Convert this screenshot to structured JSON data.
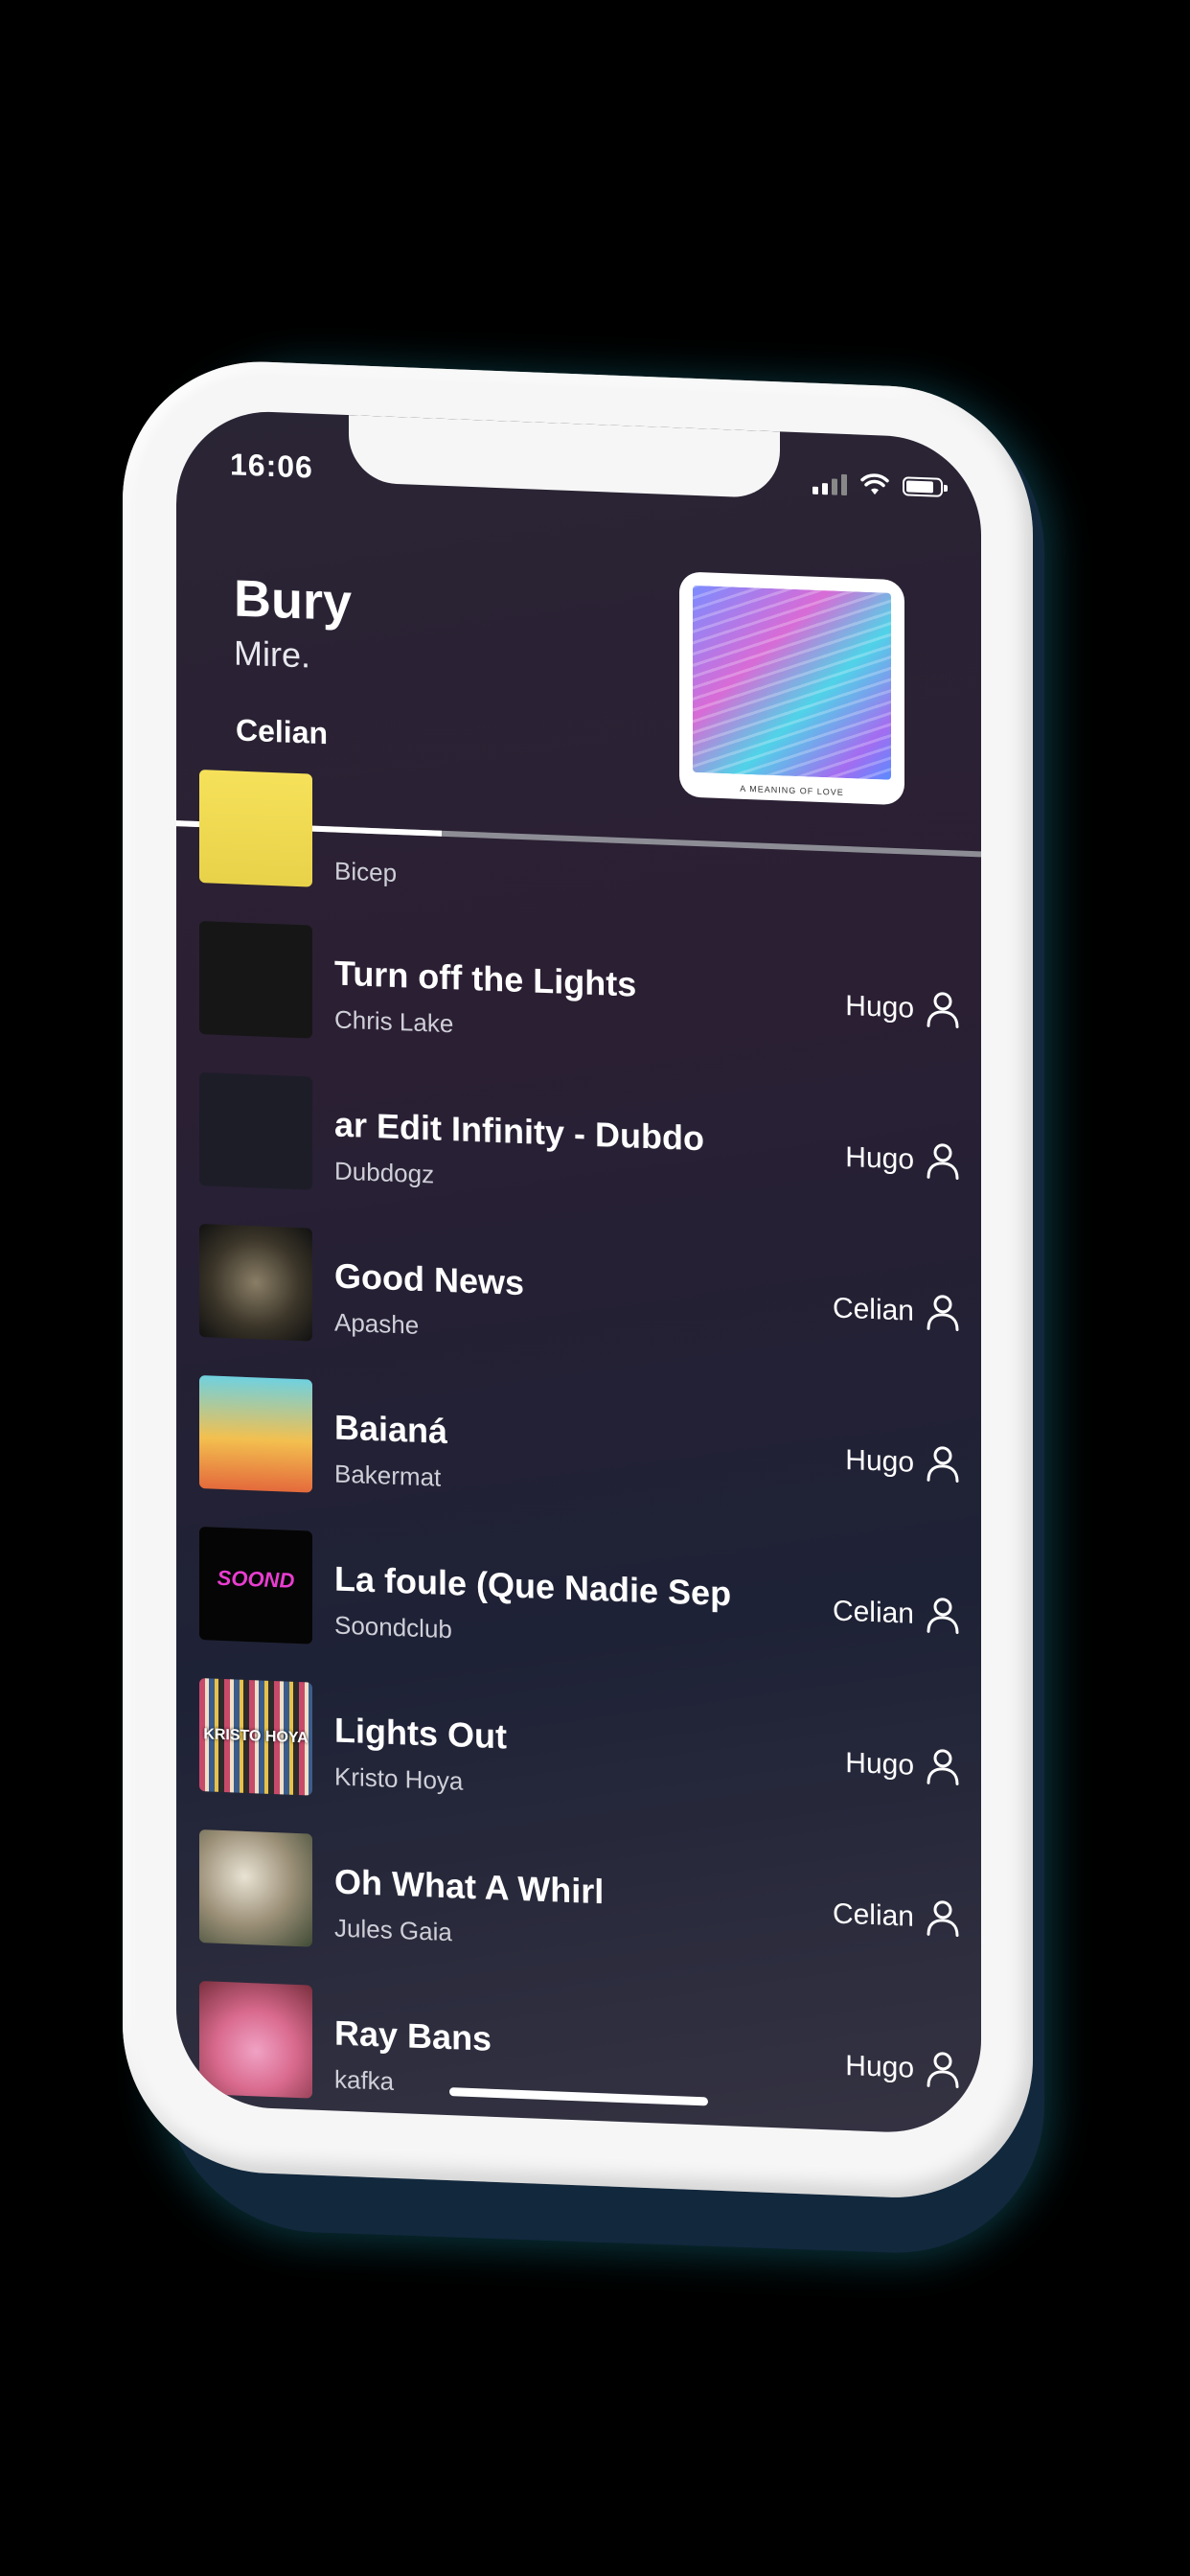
{
  "status_bar": {
    "time": "16:06"
  },
  "now_playing": {
    "title": "Bury",
    "artist": "Mire.",
    "added_by": "Celian",
    "cover_caption": "A MEANING OF LOVE",
    "progress": 0.33
  },
  "queue": [
    {
      "title": "",
      "artist": "Bicep",
      "added_by": "",
      "cover_icon": "bicep-cover"
    },
    {
      "title": "Turn off the Lights",
      "artist": "Chris Lake",
      "added_by": "Hugo",
      "cover_icon": "chris-lake-cover"
    },
    {
      "title": "ar Edit     Infinity - Dubdo",
      "artist": "Dubdogz",
      "added_by": "Hugo",
      "cover_icon": "dubdogz-cover"
    },
    {
      "title": "Good News",
      "artist": "Apashe",
      "added_by": "Celian",
      "cover_icon": "apashe-cover"
    },
    {
      "title": "Baianá",
      "artist": "Bakermat",
      "added_by": "Hugo",
      "cover_icon": "bakermat-cover"
    },
    {
      "title": "La foule (Que Nadie Sep",
      "artist": "Soondclub",
      "added_by": "Celian",
      "cover_icon": "soondclub-cover",
      "cover_text": "SOOND"
    },
    {
      "title": "Lights Out",
      "artist": "Kristo Hoya",
      "added_by": "Hugo",
      "cover_icon": "kristo-hoya-cover",
      "cover_text": "KRISTO HOYA"
    },
    {
      "title": "Oh What A Whirl",
      "artist": "Jules Gaia",
      "added_by": "Celian",
      "cover_icon": "jules-gaia-cover"
    },
    {
      "title": "Ray Bans",
      "artist": "kafka",
      "added_by": "Hugo",
      "cover_icon": "kafka-cover"
    }
  ],
  "icons": {
    "user": "user-icon",
    "wifi": "wifi-icon",
    "signal": "signal-icon",
    "battery": "battery-icon"
  }
}
